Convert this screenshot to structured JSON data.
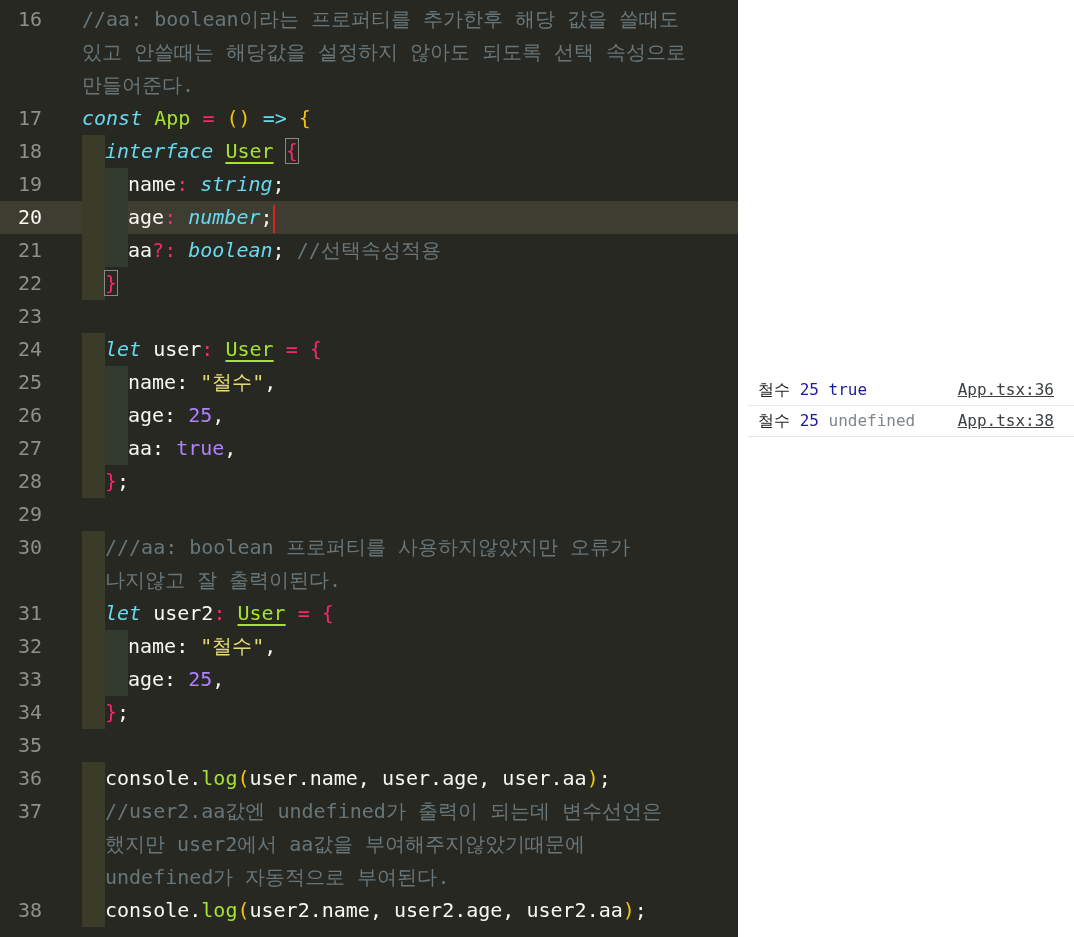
{
  "editor": {
    "lines": [
      {
        "number": "16",
        "tokens": [
          {
            "kind": "comment",
            "text": "//aa: boolean이라는 프로퍼티를 추가한후 해당 값을 쓸때도 있고 안쓸때는 해당값을 설정하지 않아도 되도록 선택 속성으로 만들어준다."
          }
        ]
      },
      {
        "number": "17",
        "tokens": [
          {
            "kind": "storage",
            "text": "const"
          },
          {
            "kind": "entity",
            "text": "App",
            "space": true
          },
          {
            "kind": "op",
            "text": "=",
            "space": true
          },
          {
            "kind": "paren",
            "text": "(",
            "space": true
          },
          {
            "kind": "paren",
            "text": ")"
          },
          {
            "kind": "arrow",
            "text": "=>",
            "space": true
          },
          {
            "kind": "brace",
            "text": "{",
            "space": true
          }
        ],
        "children": [
          {
            "number": "18",
            "tokens": [
              {
                "kind": "storage",
                "text": "interface"
              },
              {
                "kind": "class",
                "text": "User",
                "space": true
              },
              {
                "kind": "brace",
                "text": "{",
                "space": true,
                "match": true
              }
            ],
            "children": [
              {
                "number": "19",
                "tokens": [
                  {
                    "kind": "plain",
                    "text": "name"
                  },
                  {
                    "kind": "op",
                    "text": ":"
                  },
                  {
                    "kind": "type",
                    "text": "string",
                    "space": true
                  },
                  {
                    "kind": "plain",
                    "text": ";"
                  }
                ]
              },
              {
                "number": "20",
                "current": true,
                "tokens": [
                  {
                    "kind": "plain",
                    "text": "age"
                  },
                  {
                    "kind": "op",
                    "text": ":"
                  },
                  {
                    "kind": "type",
                    "text": "number",
                    "space": true
                  },
                  {
                    "kind": "plain",
                    "text": ";"
                  }
                ]
              },
              {
                "number": "21",
                "tokens": [
                  {
                    "kind": "plain",
                    "text": "aa"
                  },
                  {
                    "kind": "op",
                    "text": "?:"
                  },
                  {
                    "kind": "type",
                    "text": "boolean",
                    "space": true
                  },
                  {
                    "kind": "plain",
                    "text": ";"
                  },
                  {
                    "kind": "comment",
                    "text": "//선택속성적용",
                    "space": true
                  }
                ]
              }
            ]
          },
          {
            "number": "22",
            "tokens": [
              {
                "kind": "brace",
                "text": "}",
                "match": true
              }
            ]
          },
          {
            "number": "23"
          },
          {
            "number": "24",
            "tokens": [
              {
                "kind": "storage",
                "text": "let"
              },
              {
                "kind": "plain",
                "text": "user",
                "space": true
              },
              {
                "kind": "op",
                "text": ":"
              },
              {
                "kind": "class",
                "text": "User",
                "space": true
              },
              {
                "kind": "op",
                "text": "=",
                "space": true
              },
              {
                "kind": "op",
                "text": "{",
                "space": true
              }
            ],
            "children": [
              {
                "number": "25",
                "tokens": [
                  {
                    "kind": "plain",
                    "text": "name:"
                  },
                  {
                    "kind": "string",
                    "text": "\"철수\"",
                    "space": true
                  },
                  {
                    "kind": "plain",
                    "text": ","
                  }
                ]
              },
              {
                "number": "26",
                "tokens": [
                  {
                    "kind": "plain",
                    "text": "age:"
                  },
                  {
                    "kind": "number",
                    "text": "25",
                    "space": true
                  },
                  {
                    "kind": "plain",
                    "text": ","
                  }
                ]
              },
              {
                "number": "27",
                "tokens": [
                  {
                    "kind": "plain",
                    "text": "aa:"
                  },
                  {
                    "kind": "number",
                    "text": "true",
                    "space": true
                  },
                  {
                    "kind": "plain",
                    "text": ","
                  }
                ]
              }
            ]
          },
          {
            "number": "28",
            "tokens": [
              {
                "kind": "op",
                "text": "}"
              },
              {
                "kind": "plain",
                "text": ";"
              }
            ]
          },
          {
            "number": "29"
          },
          {
            "number": "30",
            "tokens": [
              {
                "kind": "comment",
                "text": "///aa: boolean 프로퍼티를 사용하지않았지만 오류가 나지않고 잘 출력이된다."
              }
            ]
          },
          {
            "number": "31",
            "tokens": [
              {
                "kind": "storage",
                "text": "let"
              },
              {
                "kind": "plain",
                "text": "user2",
                "space": true
              },
              {
                "kind": "op",
                "text": ":"
              },
              {
                "kind": "class",
                "text": "User",
                "space": true
              },
              {
                "kind": "op",
                "text": "=",
                "space": true
              },
              {
                "kind": "op",
                "text": "{",
                "space": true
              }
            ],
            "children": [
              {
                "number": "32",
                "tokens": [
                  {
                    "kind": "plain",
                    "text": "name:"
                  },
                  {
                    "kind": "string",
                    "text": "\"철수\"",
                    "space": true
                  },
                  {
                    "kind": "plain",
                    "text": ","
                  }
                ]
              },
              {
                "number": "33",
                "tokens": [
                  {
                    "kind": "plain",
                    "text": "age:"
                  },
                  {
                    "kind": "number",
                    "text": "25",
                    "space": true
                  },
                  {
                    "kind": "plain",
                    "text": ","
                  }
                ]
              }
            ]
          },
          {
            "number": "34",
            "tokens": [
              {
                "kind": "op",
                "text": "}"
              },
              {
                "kind": "plain",
                "text": ";"
              }
            ]
          },
          {
            "number": "35"
          },
          {
            "number": "36",
            "tokens": [
              {
                "kind": "plain",
                "text": "console."
              },
              {
                "kind": "entity",
                "text": "log"
              },
              {
                "kind": "paren",
                "text": "("
              },
              {
                "kind": "plain",
                "text": "user.name, user.age, user.aa"
              },
              {
                "kind": "paren",
                "text": ")"
              },
              {
                "kind": "plain",
                "text": ";"
              }
            ]
          },
          {
            "number": "37",
            "tokens": [
              {
                "kind": "comment",
                "text": "//user2.aa값엔 undefined가 출력이 되는데 변수선언은 했지만 user2에서 aa값을 부여해주지않았기때문에 undefined가 자동적으로 부여된다."
              }
            ]
          },
          {
            "number": "38",
            "tokens": [
              {
                "kind": "plain",
                "text": "console."
              },
              {
                "kind": "entity",
                "text": "log"
              },
              {
                "kind": "paren",
                "text": "("
              },
              {
                "kind": "plain",
                "text": "user2.name, user2.age, user2.aa"
              },
              {
                "kind": "paren",
                "text": ")"
              },
              {
                "kind": "plain",
                "text": ";"
              }
            ]
          }
        ]
      }
    ]
  },
  "console": {
    "rows": [
      {
        "parts": [
          {
            "kind": "string",
            "text": "철수"
          },
          {
            "kind": "number",
            "text": "25"
          },
          {
            "kind": "boolean",
            "text": "true"
          }
        ],
        "source": "App.tsx:36"
      },
      {
        "parts": [
          {
            "kind": "string",
            "text": "철수"
          },
          {
            "kind": "number",
            "text": "25"
          },
          {
            "kind": "undefined",
            "text": "undefined"
          }
        ],
        "source": "App.tsx:38"
      }
    ]
  }
}
